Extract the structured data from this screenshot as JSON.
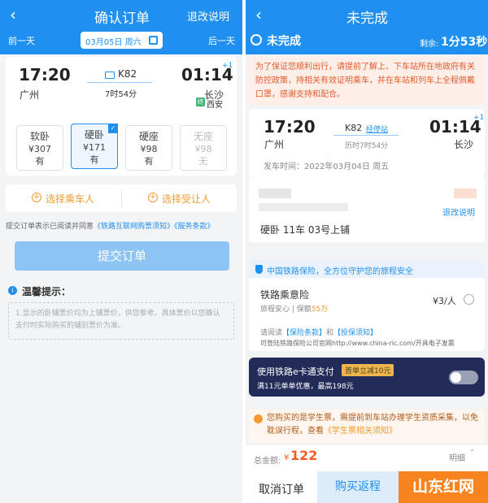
{
  "left": {
    "title": "确认订单",
    "refund_link": "退改说明",
    "prev_day": "前一天",
    "date": "03月05日 周六",
    "next_day": "后一天",
    "depart_time": "17:20",
    "depart_station": "广州",
    "train_no": "K82",
    "duration": "7时54分",
    "arrive_time": "01:14",
    "arrive_plus": "+1",
    "arrive_station": "长沙",
    "via_badge": "终",
    "via_station": "西安",
    "seats": [
      {
        "name": "软卧",
        "price": "¥307",
        "avail": "有"
      },
      {
        "name": "硬卧",
        "price": "¥171",
        "avail": "有"
      },
      {
        "name": "硬座",
        "price": "¥98",
        "avail": "有"
      },
      {
        "name": "无座",
        "price": "¥98",
        "avail": "无"
      }
    ],
    "choose_passenger": "选择乘车人",
    "choose_beneficiary": "选择受让人",
    "agree_prefix": "提交订单表示已阅读并同意",
    "agree_link1": "《铁路互联网购票须知》",
    "agree_link2": "《服务条款》",
    "submit": "提交订单",
    "tip_title": "温馨提示：",
    "tip_text": "1.显示的卧铺票价均为上铺票价，供您参考。具体票价以您确认支付时实际购买的铺别票价为准。"
  },
  "right": {
    "title": "未完成",
    "status": "未完成",
    "remain_label": "剩余:",
    "remain_time": "1分53秒",
    "notice": "为了保证您顺利出行，请提前了解上、下车站所在地政府有关防控政策，持相关有效证明乘车，并在车站和列车上全程佩戴口罩，感谢支持和配合。",
    "depart_time": "17:20",
    "depart_station": "广州",
    "train_no": "K82",
    "stop_link": "经停站",
    "duration": "历时7时54分",
    "arrive_time": "01:14",
    "arrive_plus": "+1",
    "arrive_station": "长沙",
    "depart_date": "发车时间：2022年03月04日 周五",
    "refund_link": "退改说明",
    "seat_info": "硬卧 11车 03号上铺",
    "ins_header": "中国铁路保险，全方位守护您的旅程安全",
    "ins_name": "铁路乘意险",
    "ins_price": "¥3/人",
    "ins_sub1": "旅程安心",
    "ins_sub2": "保额",
    "ins_amount": "55万",
    "ins_read": "请阅读",
    "ins_link1": "【保险条款】",
    "ins_and": "和",
    "ins_link2": "【投保须知】",
    "ins_invoice": "可登陆铁路保险公司官网http://www.china-ric.com/开具电子发票",
    "ecard_title": "使用铁路e卡通支付",
    "ecard_badge": "首单立减10元",
    "ecard_sub": "满11元单单优惠，最高198元",
    "student_text": "您购买的是学生票，需提前到车站办理学生资质采集，以免耽误行程，查看",
    "student_link": "《学生票相关须知》",
    "total_label": "总金额:",
    "total_currency": "¥",
    "total_value": "122",
    "detail_label": "明细",
    "cancel": "取消订单",
    "return_ticket": "购买返程",
    "watermark": "山东红网"
  }
}
